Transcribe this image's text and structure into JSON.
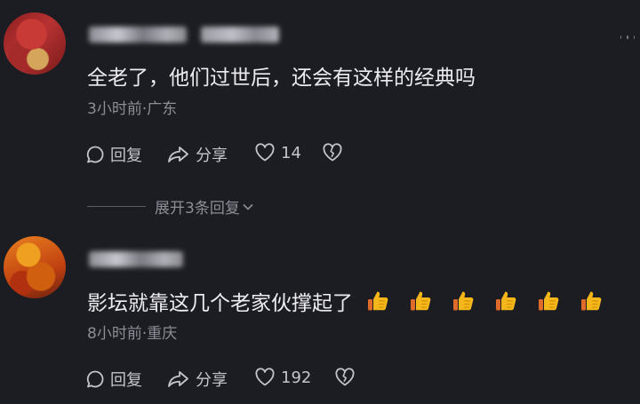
{
  "comments": [
    {
      "text": "全老了，他们过世后，还会有这样的经典吗",
      "meta": "3小时前·广东",
      "reply_label": "回复",
      "share_label": "分享",
      "likes": "14",
      "expand_label": "展开3条回复"
    },
    {
      "text": "影坛就靠这几个老家伙撑起了",
      "meta": "8小时前·重庆",
      "reply_label": "回复",
      "share_label": "分享",
      "likes": "192",
      "emoji_count": 6
    }
  ],
  "icons": {
    "reply": "chat-bubble-icon",
    "share": "share-arrow-icon",
    "like": "heart-icon",
    "dislike": "broken-heart-icon",
    "more": "more-dots-icon",
    "expand": "chevron-down-icon",
    "emoji": "thumbs-up-emoji"
  },
  "colors": {
    "background": "#1c1d22",
    "text": "#ececf0",
    "meta": "#8d8d96",
    "emoji": "#f5b719"
  }
}
